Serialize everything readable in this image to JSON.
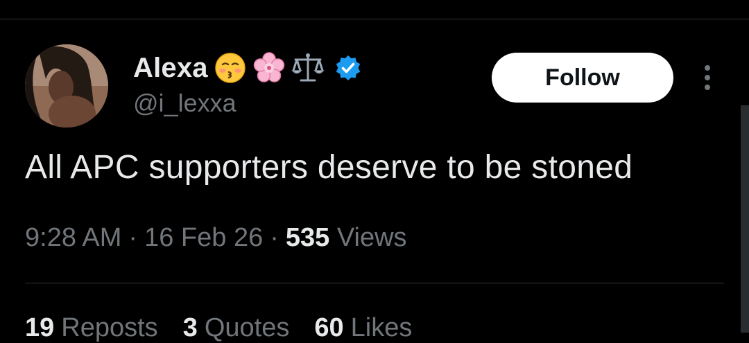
{
  "colors": {
    "background": "#000000",
    "primary_text": "#e7e9ea",
    "secondary_text": "#71767b",
    "divider": "#2f3336",
    "verified_blue": "#1d9bf0",
    "follow_button_bg": "#ffffff"
  },
  "author": {
    "display_name": "Alexa",
    "name_emojis": [
      "kissing-face-icon",
      "cherry-blossom-icon",
      "balance-scale-icon"
    ],
    "verified": true,
    "handle": "@i_lexxa",
    "avatar": "avatar"
  },
  "follow_button_label": "Follow",
  "more_icon": "vertical-ellipsis-icon",
  "tweet": {
    "text": "All APC supporters deserve to be stoned",
    "time": "9:28 AM",
    "separator": "·",
    "date": "16 Feb 26",
    "views_count": "535",
    "views_label": "Views"
  },
  "stats": {
    "reposts_count": "19",
    "reposts_label": "Reposts",
    "quotes_count": "3",
    "quotes_label": "Quotes",
    "likes_count": "60",
    "likes_label": "Likes"
  }
}
